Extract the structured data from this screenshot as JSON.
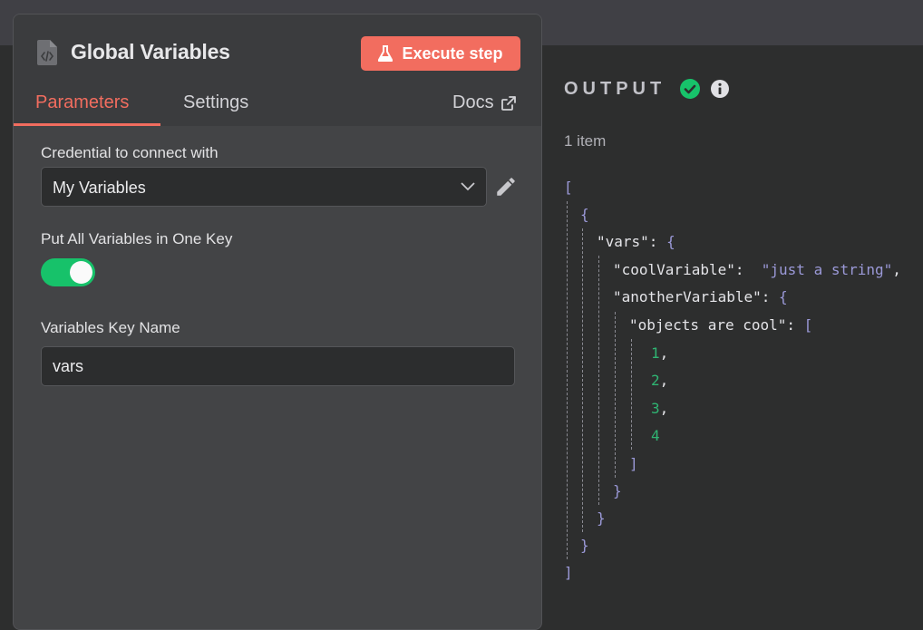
{
  "node": {
    "title": "Global Variables",
    "execute_label": "Execute step",
    "tabs": [
      {
        "label": "Parameters",
        "active": true
      },
      {
        "label": "Settings",
        "active": false
      }
    ],
    "docs_label": "Docs"
  },
  "params": {
    "credential_label": "Credential to connect with",
    "credential_value": "My Variables",
    "put_all_label": "Put All Variables in One Key",
    "put_all_on": true,
    "key_name_label": "Variables Key Name",
    "key_name_value": "vars"
  },
  "output": {
    "title": "OUTPUT",
    "count": "1 item",
    "json": {
      "root_open": "[",
      "obj_open": "{",
      "vars_key": "\"vars\"",
      "cool_key": "\"coolVariable\"",
      "cool_val": "\"just a string\"",
      "another_key": "\"anotherVariable\"",
      "objects_key": "\"objects are cool\"",
      "arr_open": "[",
      "nums": [
        "1",
        "2",
        "3",
        "4"
      ],
      "arr_close": "]",
      "inner_close": "}",
      "vars_close": "}",
      "obj_close": "}",
      "root_close": "]"
    }
  },
  "colors": {
    "accent": "#f26d5f",
    "toggle_on": "#17c26a",
    "success": "#17c26a",
    "json_punct": "#9b99d8",
    "json_number": "#2fb573"
  },
  "icons": [
    "file-code-icon",
    "flask-icon",
    "external-link-icon",
    "chevron-down-icon",
    "pencil-icon",
    "check-circle-icon",
    "info-circle-icon"
  ]
}
